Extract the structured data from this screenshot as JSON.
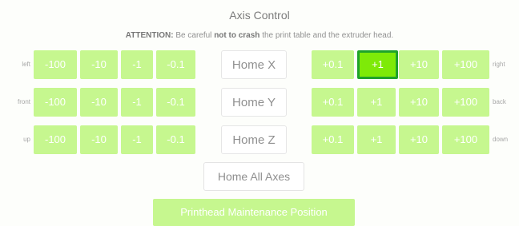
{
  "title": "Axis Control",
  "attention": {
    "label": "ATTENTION:",
    "pre": " Be careful ",
    "emph": "not to crash",
    "post": " the print table and the extruder head."
  },
  "rows": [
    {
      "left_label": "left",
      "right_label": "right",
      "home": "Home X",
      "neg": [
        "-100",
        "-10",
        "-1",
        "-0.1"
      ],
      "pos": [
        "+0.1",
        "+1",
        "+10",
        "+100"
      ],
      "selected_pos_index": 1
    },
    {
      "left_label": "front",
      "right_label": "back",
      "home": "Home Y",
      "neg": [
        "-100",
        "-10",
        "-1",
        "-0.1"
      ],
      "pos": [
        "+0.1",
        "+1",
        "+10",
        "+100"
      ]
    },
    {
      "left_label": "up",
      "right_label": "down",
      "home": "Home Z",
      "neg": [
        "-100",
        "-10",
        "-1",
        "-0.1"
      ],
      "pos": [
        "+0.1",
        "+1",
        "+10",
        "+100"
      ]
    }
  ],
  "home_all": "Home All Axes",
  "maintenance": "Printhead Maintenance Position",
  "colors": {
    "button": "#c6f78f",
    "selected": "#7eea08",
    "selected_border": "#1ea32a"
  }
}
